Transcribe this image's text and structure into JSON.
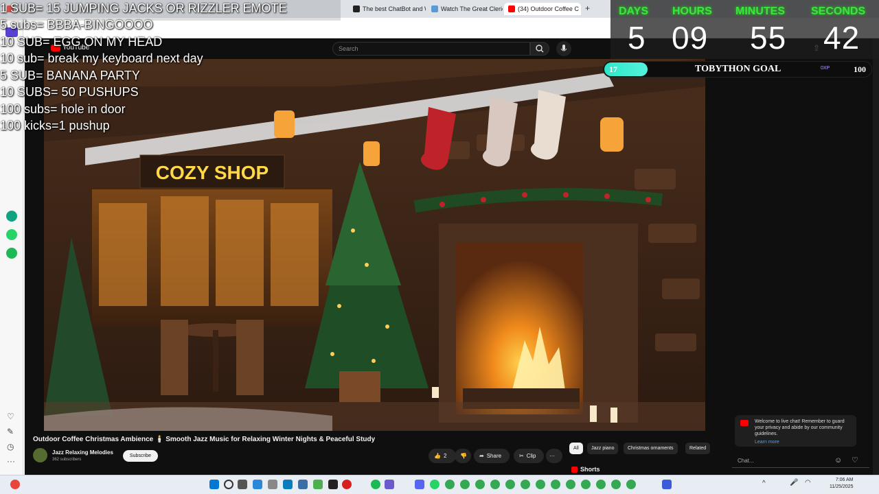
{
  "browser": {
    "tabs": [
      {
        "title": "SUB= 15 JUMPING JACKS OR RIZZLER EMOTE",
        "color": "#e8453c"
      },
      {
        "title": "The best ChatBot and Wri",
        "color": "#222222"
      },
      {
        "title": "Watch The Great Cleric Er",
        "color": "#5b9bd5"
      },
      {
        "title": "(34) Outdoor Coffee C",
        "color": "#ff0000"
      }
    ],
    "new_tab": "+"
  },
  "youtube": {
    "logo": "YouTube",
    "search_placeholder": "Search",
    "video_title": "Outdoor Coffee Christmas Ambience 🕯️ Smooth Jazz Music for Relaxing Winter Nights & Peaceful Study",
    "channel_name": "Jazz Relaxing Melodies",
    "channel_subs": "362 subscribers",
    "subscribe": "Subscribe",
    "likes": "2",
    "share": "Share",
    "clip": "Clip",
    "more": "···",
    "chips": [
      "All",
      "Jazz piano",
      "Christmas ornaments",
      "Related"
    ],
    "shorts": "Shorts",
    "scene_sign": "COZY SHOP",
    "chat_notice": "Welcome to live chat! Remember to guard your privacy and abide by our community guidelines.",
    "chat_learn_more": "Learn more",
    "chat_placeholder": "Chat..."
  },
  "overlay": {
    "lines": [
      "1 SUB= 15 JUMPING JACKS OR RIZZLER EMOTE",
      "5 subs= BBBA-BINGOOOO",
      "10 SUB= EGG ON MY HEAD",
      "10 sub= break my keyboard next day",
      "5 SUB= BANANA  PARTY",
      "10 SUBS= 50 PUSHUPS",
      "100 subs= hole in door",
      "100 kicks=1 pushup"
    ]
  },
  "countdown": {
    "labels": [
      "DAYS",
      "HOURS",
      "MINUTES",
      "SECONDS"
    ],
    "values": [
      "5",
      "09",
      "55",
      "42"
    ]
  },
  "goal": {
    "title": "TOBYTHON GOAL",
    "current": "17",
    "max": "100",
    "progress": 0.17,
    "xp_label": "0XP"
  },
  "taskbar": {
    "time": "7:06 AM",
    "date": "11/25/2025"
  }
}
